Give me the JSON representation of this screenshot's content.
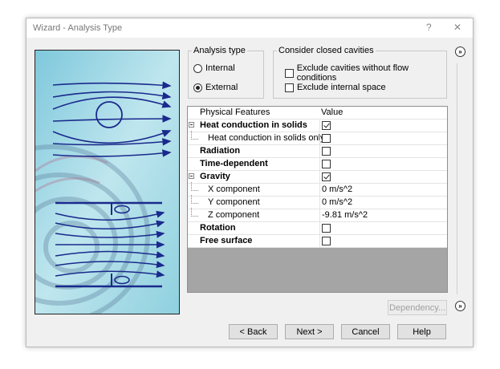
{
  "window": {
    "title": "Wizard - Analysis Type",
    "help_glyph": "?",
    "close_glyph": "✕"
  },
  "analysis_type": {
    "title": "Analysis type",
    "options": [
      {
        "label": "Internal",
        "checked": false
      },
      {
        "label": "External",
        "checked": true
      }
    ]
  },
  "cavities": {
    "title": "Consider closed cavities",
    "options": [
      {
        "label": "Exclude cavities without flow conditions",
        "checked": false
      },
      {
        "label": "Exclude internal space",
        "checked": false
      }
    ]
  },
  "grid": {
    "columns": [
      "Physical Features",
      "Value"
    ],
    "rows": [
      {
        "label": "Heat conduction in solids",
        "bold": true,
        "expander": true,
        "value_type": "check",
        "checked": true
      },
      {
        "label": "Heat conduction in solids only",
        "bold": false,
        "child": true,
        "value_type": "check",
        "checked": false
      },
      {
        "label": "Radiation",
        "bold": true,
        "value_type": "check",
        "checked": false
      },
      {
        "label": "Time-dependent",
        "bold": true,
        "value_type": "check",
        "checked": false
      },
      {
        "label": "Gravity",
        "bold": true,
        "expander": true,
        "value_type": "check",
        "checked": true
      },
      {
        "label": "X component",
        "bold": false,
        "child": true,
        "value_type": "text",
        "value": "0 m/s^2"
      },
      {
        "label": "Y component",
        "bold": false,
        "child": true,
        "value_type": "text",
        "value": "0 m/s^2"
      },
      {
        "label": "Z component",
        "bold": false,
        "child": true,
        "value_type": "text",
        "value": "-9.81 m/s^2"
      },
      {
        "label": "Rotation",
        "bold": true,
        "value_type": "check",
        "checked": false
      },
      {
        "label": "Free surface",
        "bold": true,
        "value_type": "check",
        "checked": false
      }
    ]
  },
  "buttons": {
    "dependency": "Dependency...",
    "back": "< Back",
    "next": "Next >",
    "cancel": "Cancel",
    "help": "Help"
  },
  "side_buttons": {
    "top_glyph": "»",
    "bottom_glyph": "»"
  },
  "colors": {
    "illustration_bg": "#a6dbe6",
    "arrow": "#1a2a8c",
    "grid_empty": "#a5a5a5"
  }
}
